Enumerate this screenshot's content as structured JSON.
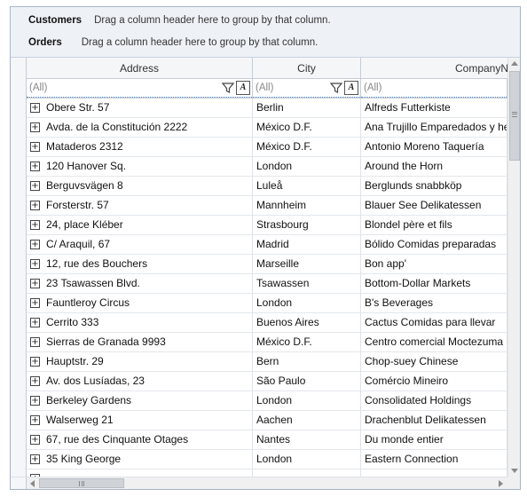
{
  "group_panel": {
    "lines": [
      {
        "label": "Customers",
        "hint": "Drag a column header here to group by that column."
      },
      {
        "label": "Orders",
        "hint": "Drag a column header here to group by that column."
      }
    ]
  },
  "columns": [
    {
      "header": "Address",
      "filter_value": "(All)"
    },
    {
      "header": "City",
      "filter_value": "(All)"
    },
    {
      "header": "CompanyNa",
      "filter_value": "(All)"
    }
  ],
  "filter_button_label": "A",
  "expander_symbol": "+",
  "icons": {
    "filter": "funnel-icon",
    "case": "match-case-icon"
  },
  "rows": [
    {
      "address": "Obere Str. 57",
      "city": "Berlin",
      "company": "Alfreds Futterkiste"
    },
    {
      "address": "Avda. de la Constitución 2222",
      "city": "México D.F.",
      "company": "Ana Trujillo Emparedados y hel"
    },
    {
      "address": "Mataderos  2312",
      "city": "México D.F.",
      "company": "Antonio Moreno Taquería"
    },
    {
      "address": "120 Hanover Sq.",
      "city": "London",
      "company": "Around the Horn"
    },
    {
      "address": "Berguvsvägen  8",
      "city": "Luleå",
      "company": "Berglunds snabbköp"
    },
    {
      "address": "Forsterstr. 57",
      "city": "Mannheim",
      "company": "Blauer See Delikatessen"
    },
    {
      "address": "24, place Kléber",
      "city": "Strasbourg",
      "company": "Blondel père et fils"
    },
    {
      "address": "C/ Araquil, 67",
      "city": "Madrid",
      "company": "Bólido Comidas preparadas"
    },
    {
      "address": "12, rue des Bouchers",
      "city": "Marseille",
      "company": "Bon app'"
    },
    {
      "address": "23 Tsawassen Blvd.",
      "city": "Tsawassen",
      "company": "Bottom-Dollar Markets"
    },
    {
      "address": "Fauntleroy Circus",
      "city": "London",
      "company": "B's Beverages"
    },
    {
      "address": "Cerrito 333",
      "city": "Buenos Aires",
      "company": "Cactus Comidas para llevar"
    },
    {
      "address": "Sierras de Granada 9993",
      "city": "México D.F.",
      "company": "Centro comercial Moctezuma"
    },
    {
      "address": "Hauptstr. 29",
      "city": "Bern",
      "company": "Chop-suey Chinese"
    },
    {
      "address": "Av. dos Lusíadas, 23",
      "city": "São Paulo",
      "company": "Comércio Mineiro"
    },
    {
      "address": "Berkeley Gardens",
      "city": "London",
      "company": "Consolidated Holdings"
    },
    {
      "address": "Walserweg 21",
      "city": "Aachen",
      "company": "Drachenblut Delikatessen"
    },
    {
      "address": "67, rue des Cinquante Otages",
      "city": "Nantes",
      "company": "Du monde entier"
    },
    {
      "address": "35 King George",
      "city": "London",
      "company": "Eastern Connection"
    },
    {
      "address": "",
      "city": "",
      "company": ""
    }
  ],
  "colors": {
    "accent": "#4a7fc1",
    "border": "#a9b5c6",
    "group_panel_bg": "#eef2f7"
  }
}
